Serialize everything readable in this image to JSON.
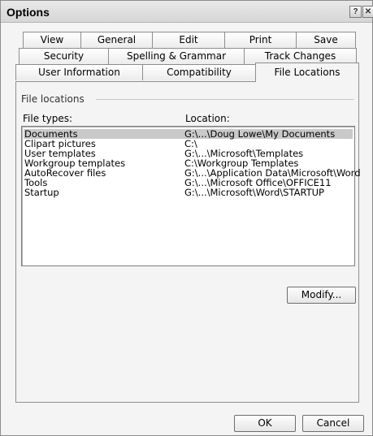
{
  "window": {
    "title": "Options",
    "help_label": "?",
    "close_label": "✕"
  },
  "tabs": {
    "row1": [
      "View",
      "General",
      "Edit",
      "Print",
      "Save"
    ],
    "row2": [
      "Security",
      "Spelling & Grammar",
      "Track Changes"
    ],
    "row3": [
      "User Information",
      "Compatibility",
      "File Locations"
    ],
    "active": "File Locations"
  },
  "file_locations": {
    "group_label": "File locations",
    "file_types_header": "File types:",
    "location_header": "Location:",
    "items": [
      {
        "type": "Documents",
        "location": "G:\\...\\Doug Lowe\\My Documents",
        "selected": true
      },
      {
        "type": "Clipart pictures",
        "location": "C:\\",
        "selected": false
      },
      {
        "type": "User templates",
        "location": "G:\\...\\Microsoft\\Templates",
        "selected": false
      },
      {
        "type": "Workgroup templates",
        "location": "C:\\Workgroup Templates",
        "selected": false
      },
      {
        "type": "AutoRecover files",
        "location": "G:\\...\\Application Data\\Microsoft\\Word",
        "selected": false
      },
      {
        "type": "Tools",
        "location": "G:\\...\\Microsoft Office\\OFFICE11",
        "selected": false
      },
      {
        "type": "Startup",
        "location": "G:\\...\\Microsoft\\Word\\STARTUP",
        "selected": false
      }
    ],
    "modify_label": "Modify..."
  },
  "footer": {
    "ok_label": "OK",
    "cancel_label": "Cancel"
  }
}
